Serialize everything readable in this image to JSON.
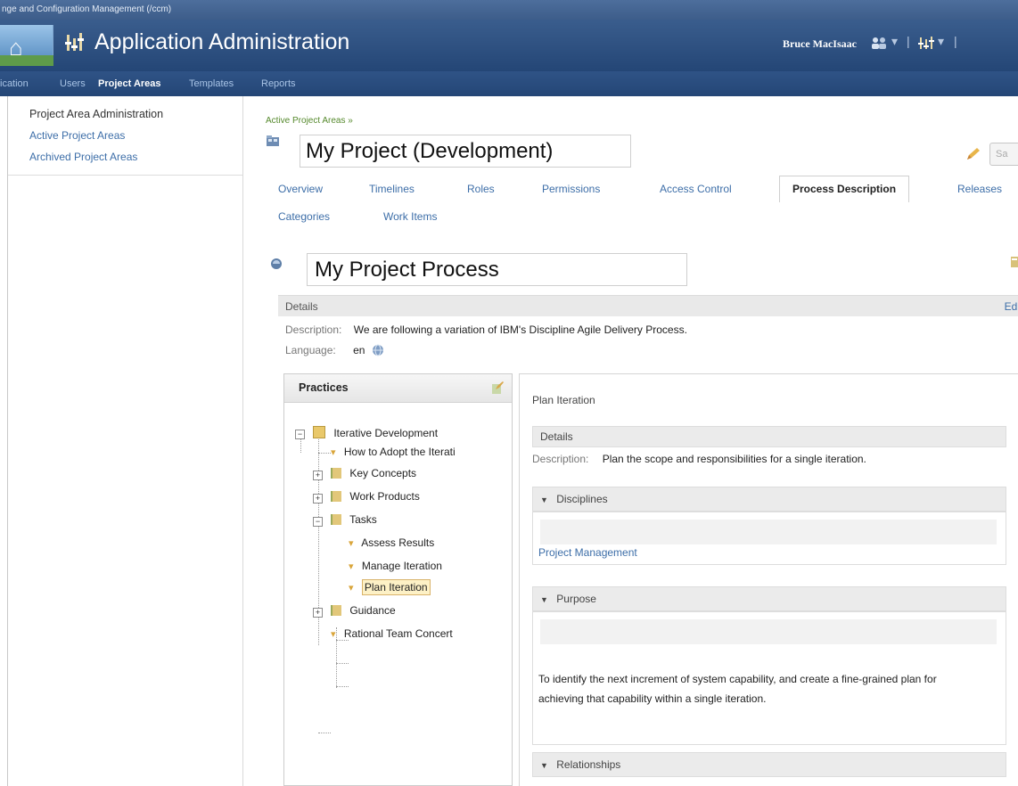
{
  "window": {
    "title_strip": "nge and Configuration Management (/ccm)"
  },
  "header": {
    "app_title": "Application Administration",
    "user_name": "Bruce MacIsaac"
  },
  "nav": {
    "items": [
      "ication",
      "Users",
      "Project Areas",
      "Templates",
      "Reports"
    ],
    "active": "Project Areas"
  },
  "sidebar": {
    "items": [
      {
        "label": "Project Area Administration"
      },
      {
        "label": "Active Project Areas"
      },
      {
        "label": "Archived Project Areas"
      }
    ]
  },
  "main": {
    "breadcrumb": "Active Project Areas »",
    "project_title": "My Project (Development)",
    "save_label": "Sa",
    "tabs": [
      {
        "label": "Overview"
      },
      {
        "label": "Timelines"
      },
      {
        "label": "Roles"
      },
      {
        "label": "Permissions"
      },
      {
        "label": "Access Control"
      },
      {
        "label": "Process Description"
      },
      {
        "label": "Releases"
      },
      {
        "label": "Categories"
      },
      {
        "label": "Work Items"
      }
    ],
    "active_tab": "Process Description",
    "process_title": "My Project Process",
    "details": {
      "label": "Details",
      "edit_label": "Edi",
      "description_label": "Description:",
      "description_value": "We are following a variation of IBM's Discipline Agile Delivery Process.",
      "language_label": "Language:",
      "language_value": "en"
    }
  },
  "practices": {
    "header": "Practices",
    "tree": [
      {
        "label": "Iterative Development",
        "expander": "−"
      },
      {
        "label": "How to Adopt the Iterati"
      },
      {
        "label": "Key Concepts",
        "expander": "+"
      },
      {
        "label": "Work Products",
        "expander": "+"
      },
      {
        "label": "Tasks",
        "expander": "−"
      },
      {
        "label": "Assess Results"
      },
      {
        "label": "Manage Iteration"
      },
      {
        "label": "Plan Iteration",
        "selected": true
      },
      {
        "label": "Guidance",
        "expander": "+"
      },
      {
        "label": "Rational Team Concert"
      }
    ]
  },
  "content": {
    "title": "Plan Iteration",
    "details_label": "Details",
    "description_label": "Description:",
    "description_value": "Plan the scope and responsibilities for a single iteration.",
    "disciplines_label": "Disciplines",
    "discipline_link": "Project Management",
    "purpose_label": "Purpose",
    "purpose_text": "To identify the next increment of system capability, and create a fine-grained plan for achieving that capability within a single iteration.",
    "relationships_label": "Relationships"
  },
  "colors": {
    "header_bg": "#2c4f80",
    "link": "#3d6ea8",
    "breadcrumb": "#55892c",
    "selected_bg": "#fdf1c6"
  }
}
